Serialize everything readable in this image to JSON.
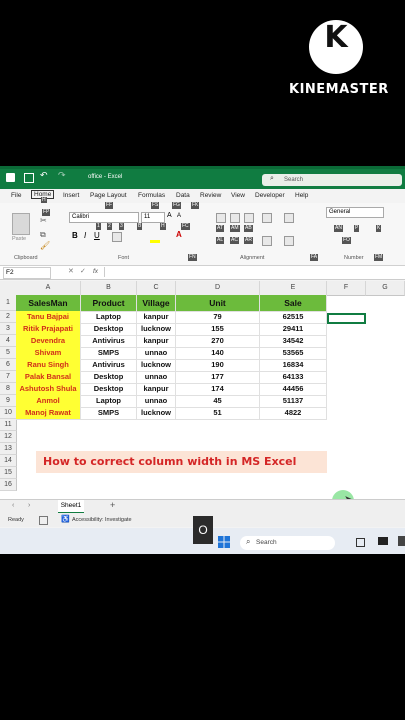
{
  "watermark": {
    "logo_letter": "K",
    "brand": "KINEMASTER"
  },
  "window": {
    "title": "office - Excel",
    "search_placeholder": "Search"
  },
  "menu": [
    "File",
    "Home",
    "Insert",
    "Page Layout",
    "Formulas",
    "Data",
    "Review",
    "View",
    "Developer",
    "Help"
  ],
  "ribbon": {
    "font_name": "Calibri",
    "font_size": "11",
    "number_format": "General",
    "paste_label": "Paste",
    "groups": {
      "clipboard": "Clipboard",
      "font": "Font",
      "alignment": "Alignment",
      "number": "Number"
    },
    "keytips": {
      "file": "F",
      "home": "H",
      "fp": "FP",
      "fs": "FS",
      "fg": "FG",
      "fk": "FK",
      "ff": "FF",
      "n1": "1",
      "n2": "2",
      "n3": "3",
      "b": "B",
      "h": "H",
      "fc": "FC",
      "at": "AT",
      "am": "AM",
      "ab": "AB",
      "al": "AL",
      "ac": "AC",
      "ar": "AR",
      "an": "AN",
      "p": "P",
      "k": "K",
      "fo": "FO",
      "fn": "FN",
      "fa": "FA",
      "fm": "FM"
    }
  },
  "formula_bar": {
    "name_box": "F2",
    "fx": "fx"
  },
  "grid": {
    "columns": [
      "A",
      "B",
      "C",
      "D",
      "E",
      "F",
      "G"
    ],
    "rows": [
      "1",
      "2",
      "3",
      "4",
      "5",
      "6",
      "7",
      "8",
      "9",
      "10",
      "11",
      "12",
      "13",
      "14",
      "15",
      "16"
    ],
    "headers": [
      "SalesMan",
      "Product",
      "Village",
      "Unit",
      "Sale"
    ],
    "data": [
      [
        "Tanu Bajpai",
        "Laptop",
        "kanpur",
        "79",
        "62515"
      ],
      [
        "Ritik Prajapati",
        "Desktop",
        "lucknow",
        "155",
        "29411"
      ],
      [
        "Devendra",
        "Antivirus",
        "kanpur",
        "270",
        "34542"
      ],
      [
        "Shivam",
        "SMPS",
        "unnao",
        "140",
        "53565"
      ],
      [
        "Ranu Singh",
        "Antivirus",
        "lucknow",
        "190",
        "16834"
      ],
      [
        "Palak Bansal",
        "Desktop",
        "unnao",
        "177",
        "64133"
      ],
      [
        "Ashutosh Shula",
        "Desktop",
        "kanpur",
        "174",
        "44456"
      ],
      [
        "Anmol",
        "Laptop",
        "unnao",
        "45",
        "51137"
      ],
      [
        "Manoj Rawat",
        "SMPS",
        "lucknow",
        "51",
        "4822"
      ]
    ]
  },
  "banner": "How to correct column width in MS Excel",
  "sheet_tab": "Sheet1",
  "status": {
    "ready": "Ready",
    "accessibility": "Accessibility: Investigate"
  },
  "taskbar": {
    "search": "Search"
  },
  "overlay_key": "O",
  "colors": {
    "excel_green": "#107c41",
    "header_fill": "#6cbb3c",
    "name_fill": "#ffff33",
    "name_text": "#d12f1a",
    "banner_fill": "#fce4d6",
    "banner_text": "#d42626"
  }
}
